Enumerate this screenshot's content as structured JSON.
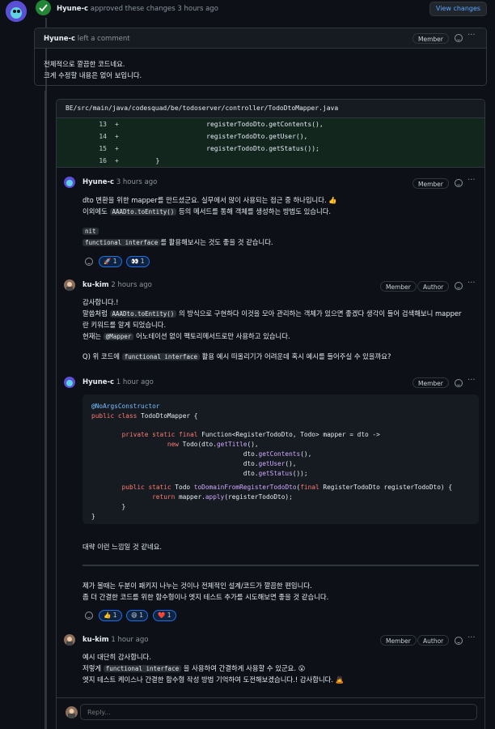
{
  "header": {
    "reviewer": "Hyune-c",
    "action_text": "approved these changes 3 hours ago",
    "view_changes_label": "View changes"
  },
  "review_comment": {
    "author": "Hyune-c",
    "action": "left a comment",
    "badge": "Member",
    "lines": [
      "전체적으로 깔끔한 코드네요.",
      "크게 수정할 내용은 없어 보입니다."
    ]
  },
  "file": {
    "path": "BE/src/main/java/codesquad/be/todoserver/controller/TodoDtoMapper.java",
    "diff": [
      {
        "num": "13",
        "sign": "+",
        "code": "                     registerTodoDto.getContents(),"
      },
      {
        "num": "14",
        "sign": "+",
        "code": "                     registerTodoDto.getUser(),"
      },
      {
        "num": "15",
        "sign": "+",
        "code": "                     registerTodoDto.getStatus());"
      },
      {
        "num": "16",
        "sign": "+",
        "code": "        }"
      }
    ]
  },
  "comments": [
    {
      "author": "Hyune-c",
      "time": "3 hours ago",
      "badges": [
        "Member"
      ],
      "p1_a": "dto 변환을 위한 mapper를 만드셨군요. 실무에서 많이 사용되는 접근 중 하나입니다.",
      "p1_emoji": "👍",
      "p2_a": "이외에도",
      "p2_code": "AAADto.toEntity()",
      "p2_b": "등의 메서드를 통해 객체를 생성하는 방법도 있습니다.",
      "nit_code": "nit",
      "fi_code": "functional interface",
      "fi_text": "를 활용해보시는 것도 좋을 것 같습니다.",
      "reactions": [
        {
          "emoji": "🚀",
          "count": "1"
        },
        {
          "emoji": "👀",
          "count": "1"
        }
      ]
    },
    {
      "author": "ku-kim",
      "time": "2 hours ago",
      "badges": [
        "Member",
        "Author"
      ],
      "l1": "감사합니다.!",
      "l2_a": "말씀처럼",
      "l2_code": "AAADto.toEntity()",
      "l2_b": "의 방식으로 구현하다 이것을 모아 관리하는 객체가 있으면 좋겠다 생각이 들어 검색해보니 mapper",
      "l3": "란 키워드를 알게 되었습니다.",
      "l4_a": "현재는",
      "l4_code": "@Mapper",
      "l4_b": "어노테이션 없이 팩토리메서드로만 사용하고 있습니다.",
      "q_a": "Q) 위 코드에",
      "q_code": "functional interface",
      "q_b": "활용 예시 떠올리기가 어려운데 혹시 예시를 들어주실 수 있을까요?"
    },
    {
      "author": "Hyune-c",
      "time": "1 hour ago",
      "badges": [
        "Member"
      ],
      "code_lines": [
        "@NoArgsConstructor",
        "public class TodoDtoMapper {",
        "",
        "        private static final Function<RegisterTodoDto, Todo> mapper = dto ->",
        "                    new Todo(dto.getTitle(),",
        "                                        dto.getContents(),",
        "                                        dto.getUser(),",
        "                                        dto.getStatus());",
        "",
        "        public static Todo toDomainFromRegisterTodoDto(final RegisterTodoDto registerTodoDto) {",
        "                return mapper.apply(registerTodoDto);",
        "        }",
        "}"
      ],
      "after_code": "대략 이런 느낌일 것 같네요.",
      "l_a": "제가 볼때는 두분이 패키지 나누는 것이나 전체적인 설계/코드가 깔끔한 편입니다.",
      "l_b": "좀 더 간결한 코드를 위한 함수형이나 엣지 테스트 추가를 시도해보면 좋을 것 같습니다.",
      "reactions": [
        {
          "emoji": "👍",
          "count": "1"
        },
        {
          "emoji": "😄",
          "count": "1"
        },
        {
          "emoji": "❤️",
          "count": "1"
        }
      ]
    },
    {
      "author": "ku-kim",
      "time": "1 hour ago",
      "badges": [
        "Member",
        "Author"
      ],
      "l1": "예시 대단히 감사합니다.",
      "l2_a": "저렇게",
      "l2_code": "functional interface",
      "l2_b": "을 사용하여 간결하게 사용할 수 있군요.",
      "l2_emoji": "😮",
      "l3": "엣지 테스트 케이스나 간결한 함수형 작성 방법 기억하여 도전해보겠습니다.! 감사합니다.",
      "l3_emoji": "🙇"
    }
  ],
  "reply": {
    "placeholder": "Reply..."
  },
  "colors": {
    "bg": "#0d1117",
    "border": "#30363d",
    "approved": "#238636",
    "link": "#58a6ff"
  }
}
